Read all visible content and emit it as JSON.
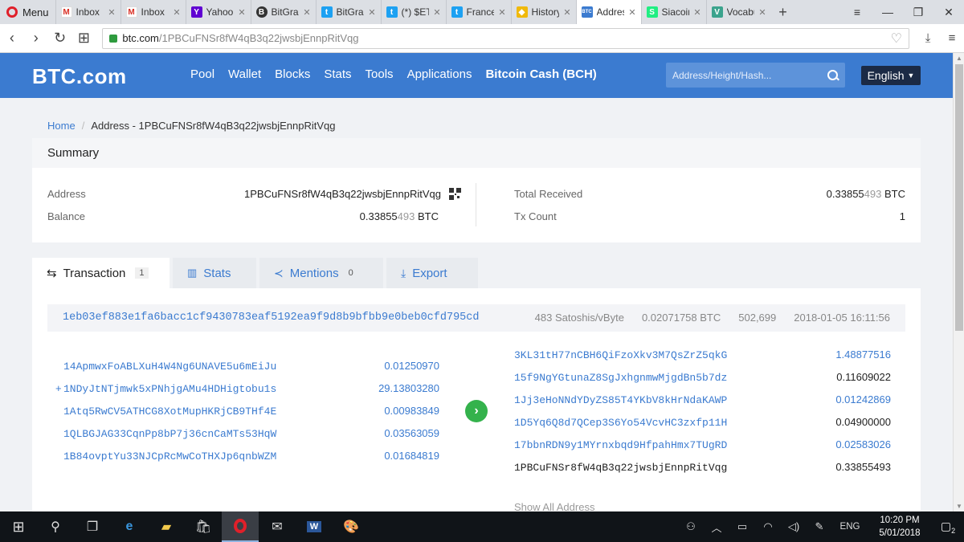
{
  "browser": {
    "menu_label": "Menu",
    "tabs": [
      {
        "label": "Inbox",
        "icon": "gmail-icon",
        "color": "#d93025"
      },
      {
        "label": "Inbox",
        "icon": "gmail-icon",
        "color": "#d93025"
      },
      {
        "label": "Yahoo",
        "icon": "yahoo-icon",
        "color": "#6001d2"
      },
      {
        "label": "BitGrail",
        "icon": "bitgrail-icon",
        "color": "#333333"
      },
      {
        "label": "BitGrail",
        "icon": "twitter-icon",
        "color": "#1da1f2"
      },
      {
        "label": "(*) $ETN",
        "icon": "twitter-icon",
        "color": "#1da1f2"
      },
      {
        "label": "France",
        "icon": "twitter-icon",
        "color": "#1da1f2"
      },
      {
        "label": "History-Bi",
        "icon": "binance-icon",
        "color": "#f0b90b"
      },
      {
        "label": "Address",
        "icon": "btc-icon",
        "color": "#3b7bd0"
      },
      {
        "label": "Siacoin (SC",
        "icon": "siacoin-icon",
        "color": "#20ee82"
      },
      {
        "label": "Vocabulary",
        "icon": "vocab-icon",
        "color": "#3ba38d"
      }
    ],
    "url_host": "btc.com",
    "url_path": "/1PBCuFNSr8fW4qB3q22jwsbjEnnpRitVqg"
  },
  "site": {
    "logo": "BTC.com",
    "nav": [
      "Pool",
      "Wallet",
      "Blocks",
      "Stats",
      "Tools",
      "Applications"
    ],
    "nav_bold": "Bitcoin Cash (BCH)",
    "search_placeholder": "Address/Height/Hash...",
    "language": "English"
  },
  "breadcrumb": {
    "home": "Home",
    "current": "Address - 1PBCuFNSr8fW4qB3q22jwsbjEnnpRitVqg"
  },
  "summary": {
    "title": "Summary",
    "address_label": "Address",
    "address_value": "1PBCuFNSr8fW4qB3q22jwsbjEnnpRitVqg",
    "balance_label": "Balance",
    "balance_main": "0.33855",
    "balance_dim": "493",
    "balance_unit": "BTC",
    "total_received_label": "Total Received",
    "total_received_main": "0.33855",
    "total_received_dim": "493",
    "total_received_unit": "BTC",
    "tx_count_label": "Tx Count",
    "tx_count_value": "1"
  },
  "content_tabs": [
    {
      "label": "Transaction",
      "count": "1",
      "icon": "swap-arrows-icon"
    },
    {
      "label": "Stats",
      "count": "",
      "icon": "bar-chart-icon"
    },
    {
      "label": "Mentions",
      "count": "0",
      "icon": "share-icon"
    },
    {
      "label": "Export",
      "count": "",
      "icon": "download-icon"
    }
  ],
  "transaction": {
    "hash": "1eb03ef883e1fa6bacc1cf9430783eaf5192ea9f9d8b9bfbb9e0beb0cfd795cd",
    "fee_rate": "483 Satoshis/vByte",
    "fee": "0.02071758 BTC",
    "block": "502,699",
    "time": "2018-01-05 16:11:56",
    "inputs": [
      {
        "address": "14ApmwxFoABLXuH4W4Ng6UNAVE5u6mEiJu",
        "amount": "0.01250970"
      },
      {
        "address": "1NDyJtNTjmwk5xPNhjgAMu4HDHigtobu1s",
        "amount": "29.13803280"
      },
      {
        "address": "1Atq5RwCV5ATHCG8XotMupHKRjCB9THf4E",
        "amount": "0.00983849"
      },
      {
        "address": "1QLBGJAG33CqnPp8bP7j36cnCaMTs53HqW",
        "amount": "0.03563059"
      },
      {
        "address": "1B84ovptYu33NJCpRcMwCoTHXJp6qnbWZM",
        "amount": "0.01684819"
      }
    ],
    "outputs": [
      {
        "address": "3KL31tH77nCBH6QiFzoXkv3M7QsZrZ5qkG",
        "amount": "1.48877516"
      },
      {
        "address": "15f9NgYGtunaZ8SgJxhgnmwMjgdBn5b7dz",
        "amount": "0.11609022"
      },
      {
        "address": "1Jj3eHoNNdYDyZS85T4YKbV8kHrNdaKAWP",
        "amount": "0.01242869"
      },
      {
        "address": "1D5Yq6Q8d7QCep3S6Yo54VcvHC3zxfp11H",
        "amount": "0.04900000"
      },
      {
        "address": "17bbnRDN9y1MYrnxbqd9HfpahHmx7TUgRD",
        "amount": "0.02583026"
      },
      {
        "address": "1PBCuFNSr8fW4qB3q22jwsbjEnnpRitVqg",
        "amount": "0.33855493"
      }
    ],
    "show_all": "Show All Address"
  },
  "taskbar": {
    "language": "ENG",
    "time": "10:20 PM",
    "date": "5/01/2018",
    "notifications": "2"
  }
}
